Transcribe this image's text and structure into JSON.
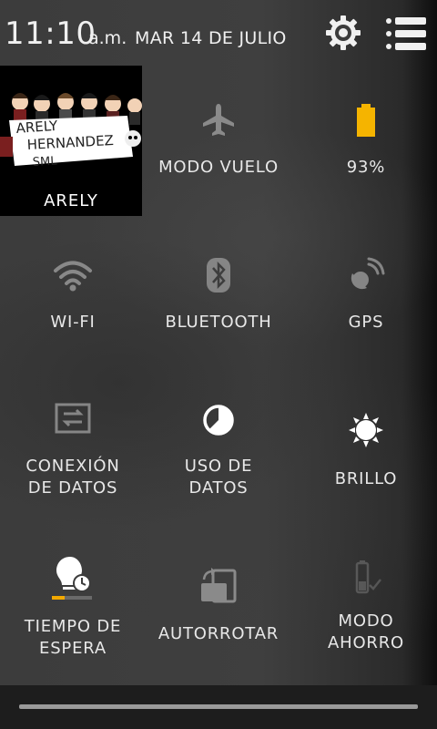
{
  "status": {
    "time": "11:10",
    "ampm": "a.m.",
    "date": "MAR 14 DE JULIO"
  },
  "profile": {
    "name": "ARELY",
    "art_text": [
      "ARELY",
      "HERNANDEZ",
      "SML"
    ]
  },
  "tiles": {
    "airplane": {
      "label": "MODO VUELO",
      "icon": "airplane-icon"
    },
    "battery": {
      "label": "93%",
      "icon": "battery-icon",
      "level": 0.93
    },
    "wifi": {
      "label": "WI-FI",
      "icon": "wifi-icon"
    },
    "bluetooth": {
      "label": "BLUETOOTH",
      "icon": "bluetooth-icon"
    },
    "gps": {
      "label": "GPS",
      "icon": "gps-icon"
    },
    "data_connection": {
      "label": "CONEXIÓN\nDE DATOS",
      "icon": "data-connection-icon"
    },
    "data_usage": {
      "label": "USO DE\nDATOS",
      "icon": "data-usage-icon"
    },
    "brightness": {
      "label": "BRILLO",
      "icon": "brightness-icon"
    },
    "timeout": {
      "label": "TIEMPO DE\nESPERA",
      "icon": "screen-timeout-icon"
    },
    "autorotate": {
      "label": "AUTORROTAR",
      "icon": "autorotate-icon"
    },
    "power_save": {
      "label": "MODO\nAHORRO",
      "icon": "power-save-icon"
    }
  },
  "colors": {
    "battery": "#f5b400",
    "timeout_bar": "#f2a900",
    "icon_dim": "#bdbdbd",
    "icon_active": "#ffffff"
  }
}
